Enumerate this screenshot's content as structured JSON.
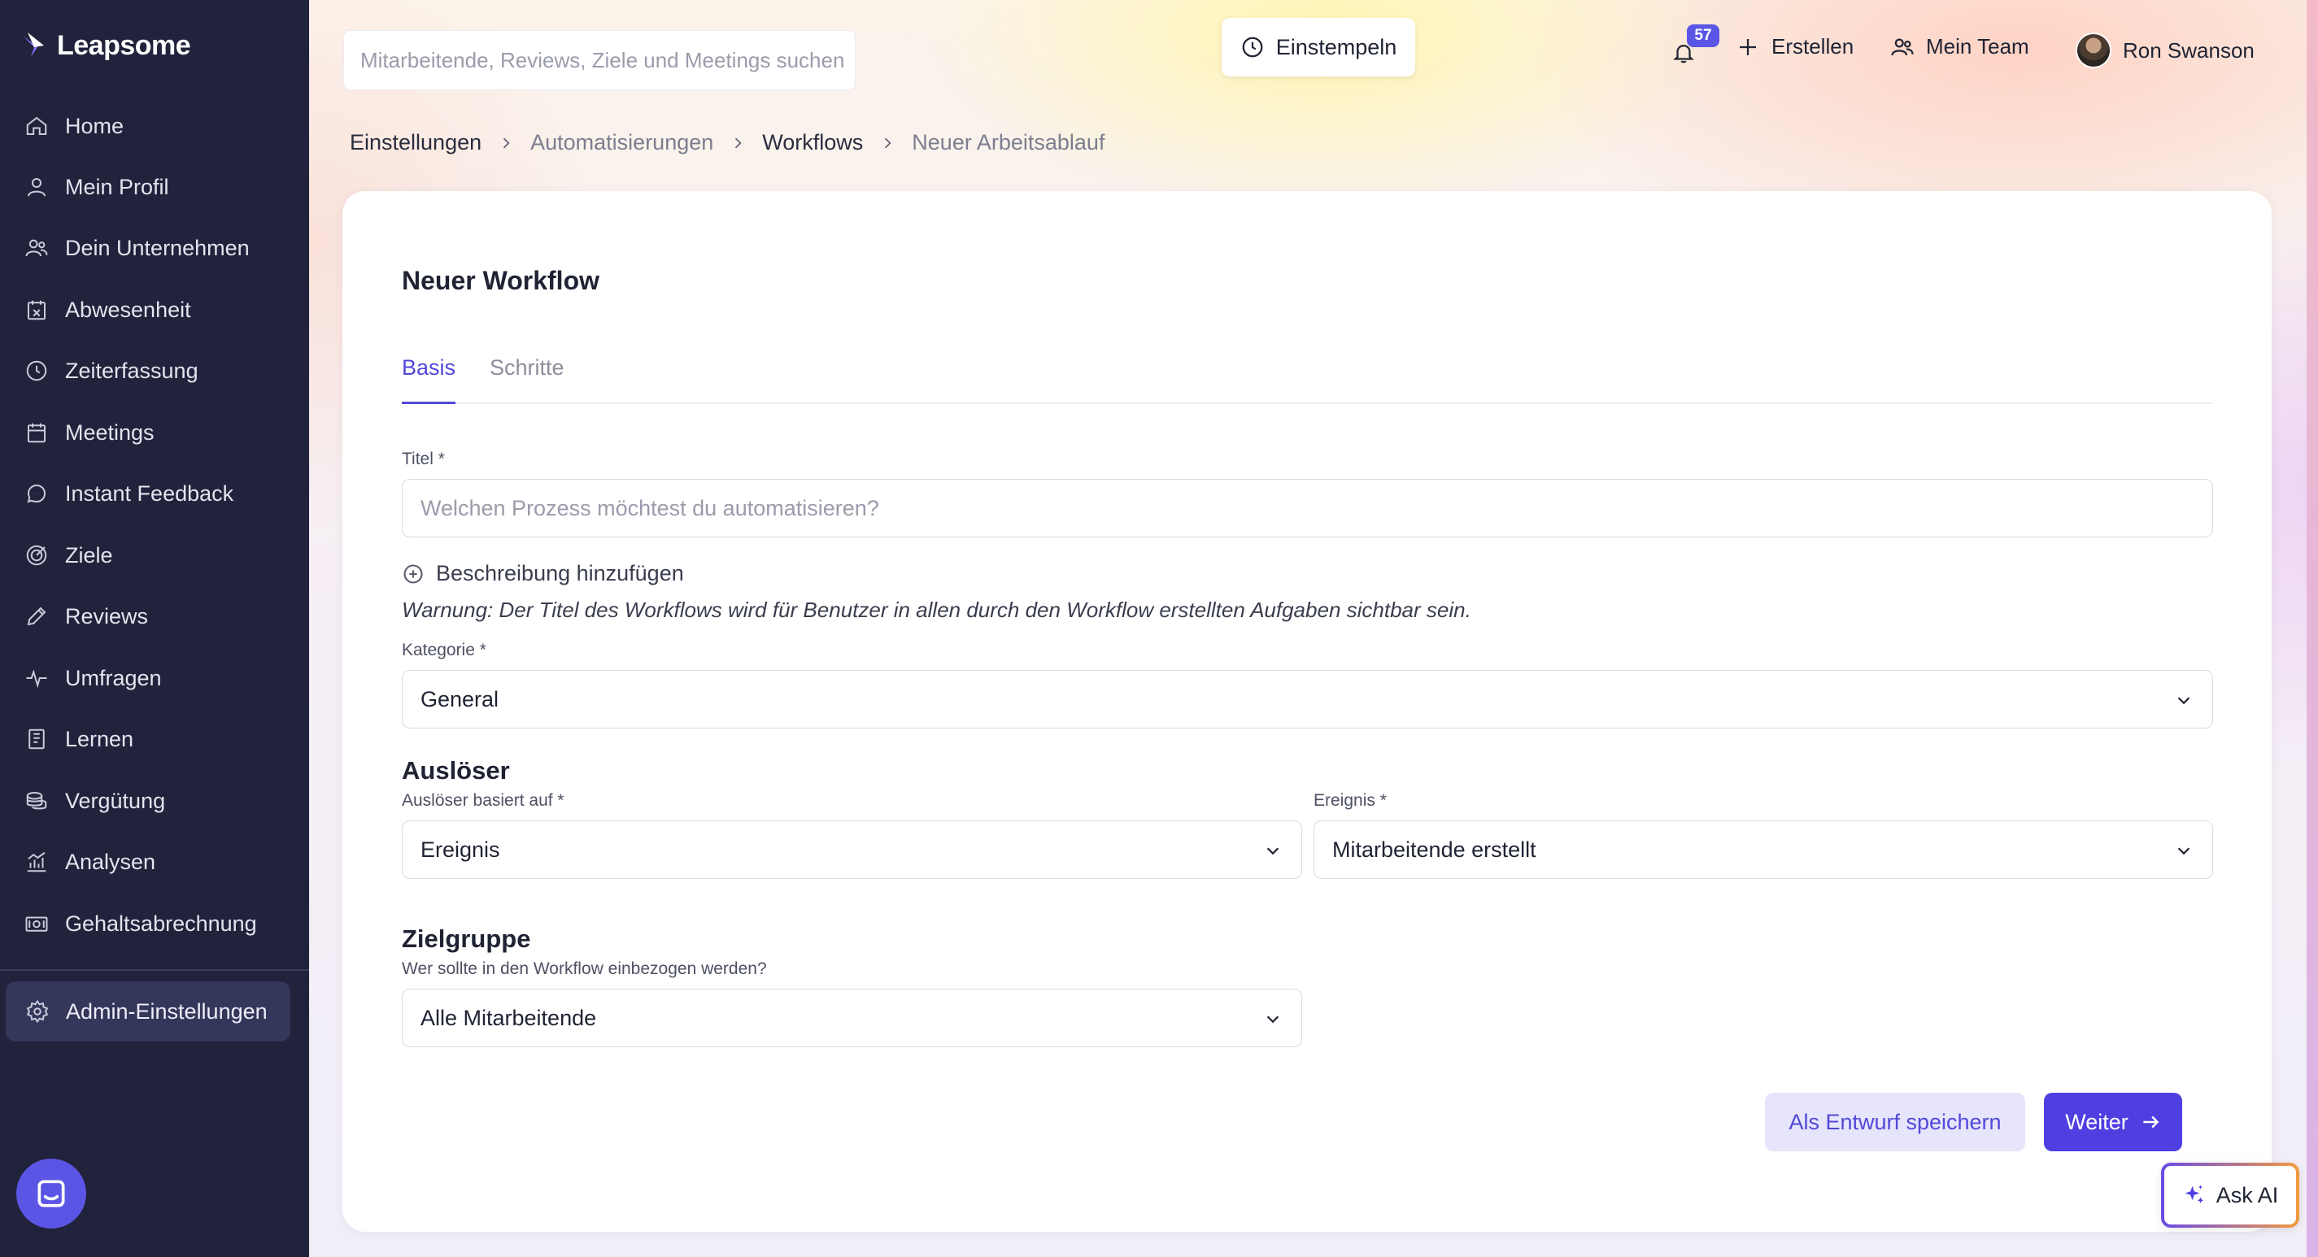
{
  "app": {
    "logo_text": "Leapsome"
  },
  "sidebar": {
    "items": [
      {
        "label": "Home",
        "icon": "home-icon"
      },
      {
        "label": "Mein Profil",
        "icon": "user-icon"
      },
      {
        "label": "Dein Unternehmen",
        "icon": "users-icon"
      },
      {
        "label": "Abwesenheit",
        "icon": "calendar-x-icon"
      },
      {
        "label": "Zeiterfassung",
        "icon": "clock-icon"
      },
      {
        "label": "Meetings",
        "icon": "calendar-icon"
      },
      {
        "label": "Instant Feedback",
        "icon": "chat-icon"
      },
      {
        "label": "Ziele",
        "icon": "target-icon"
      },
      {
        "label": "Reviews",
        "icon": "pencil-icon"
      },
      {
        "label": "Umfragen",
        "icon": "pulse-icon"
      },
      {
        "label": "Lernen",
        "icon": "book-icon"
      },
      {
        "label": "Vergütung",
        "icon": "coins-icon"
      },
      {
        "label": "Analysen",
        "icon": "chart-icon"
      },
      {
        "label": "Gehaltsabrechnung",
        "icon": "cash-icon"
      }
    ],
    "admin_label": "Admin-Einstellungen"
  },
  "topbar": {
    "search_placeholder": "Mitarbeitende, Reviews, Ziele und Meetings suchen",
    "clock_in_label": "Einstempeln",
    "notification_count": "57",
    "create_label": "Erstellen",
    "team_label": "Mein Team",
    "user_name": "Ron Swanson"
  },
  "breadcrumb": [
    "Einstellungen",
    "Automatisierungen",
    "Workflows",
    "Neuer Arbeitsablauf"
  ],
  "form": {
    "title": "Neuer Workflow",
    "tabs": [
      "Basis",
      "Schritte"
    ],
    "title_label": "Titel *",
    "title_placeholder": "Welchen Prozess möchtest du automatisieren?",
    "add_description_label": "Beschreibung hinzufügen",
    "warning": "Warnung: Der Titel des Workflows wird für Benutzer in allen durch den Workflow erstellten Aufgaben sichtbar sein.",
    "category_label": "Kategorie *",
    "category_value": "General",
    "trigger_section": "Auslöser",
    "trigger_based_label": "Auslöser basiert auf *",
    "trigger_based_value": "Ereignis",
    "event_label": "Ereignis *",
    "event_value": "Mitarbeitende erstellt",
    "audience_section": "Zielgruppe",
    "audience_hint": "Wer sollte in den Workflow einbezogen werden?",
    "audience_value": "Alle Mitarbeitende",
    "save_draft_label": "Als Entwurf speichern",
    "next_label": "Weiter"
  },
  "ask_ai_label": "Ask AI",
  "colors": {
    "sidebar_bg": "#21223b",
    "accent": "#5148d8",
    "primary_button": "#4f3fe0"
  }
}
